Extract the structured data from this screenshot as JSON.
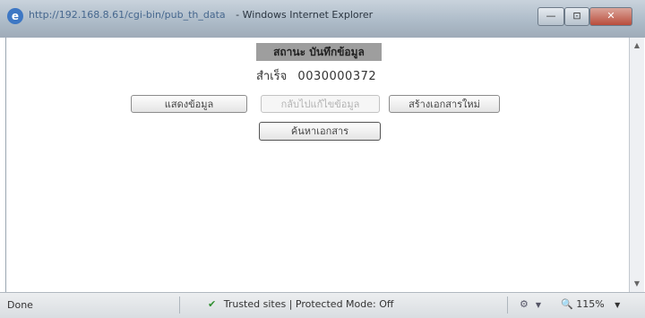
{
  "window": {
    "url_text": "http://192.168.8.61/cgi-bin/pub_th_data",
    "title_text": "- Windows Internet Explorer",
    "minimize_symbol": "—",
    "maximize_symbol": "⊡",
    "close_symbol": "✕"
  },
  "page": {
    "status_header": "สถานะ บันทึกข้อมูล",
    "id_label": "สำเร็จ",
    "id_value": "0030000372",
    "buttons": {
      "show_data": "แสดงข้อมูล",
      "cancel_data": "กลับไปแก้ไขข้อมูล",
      "new_document": "สร้างเอกสารใหม่",
      "search_document": "ค้นหาเอกสาร"
    }
  },
  "statusbar": {
    "done_text": "Done",
    "zone_text": "Trusted sites | Protected Mode: Off",
    "zoom_text": "115%",
    "dropdown_symbol": "▼"
  },
  "colors": {
    "titlebar": "#aebcc9",
    "header_bg": "#9e9e9e",
    "checkmark": "#2f8f2f"
  }
}
